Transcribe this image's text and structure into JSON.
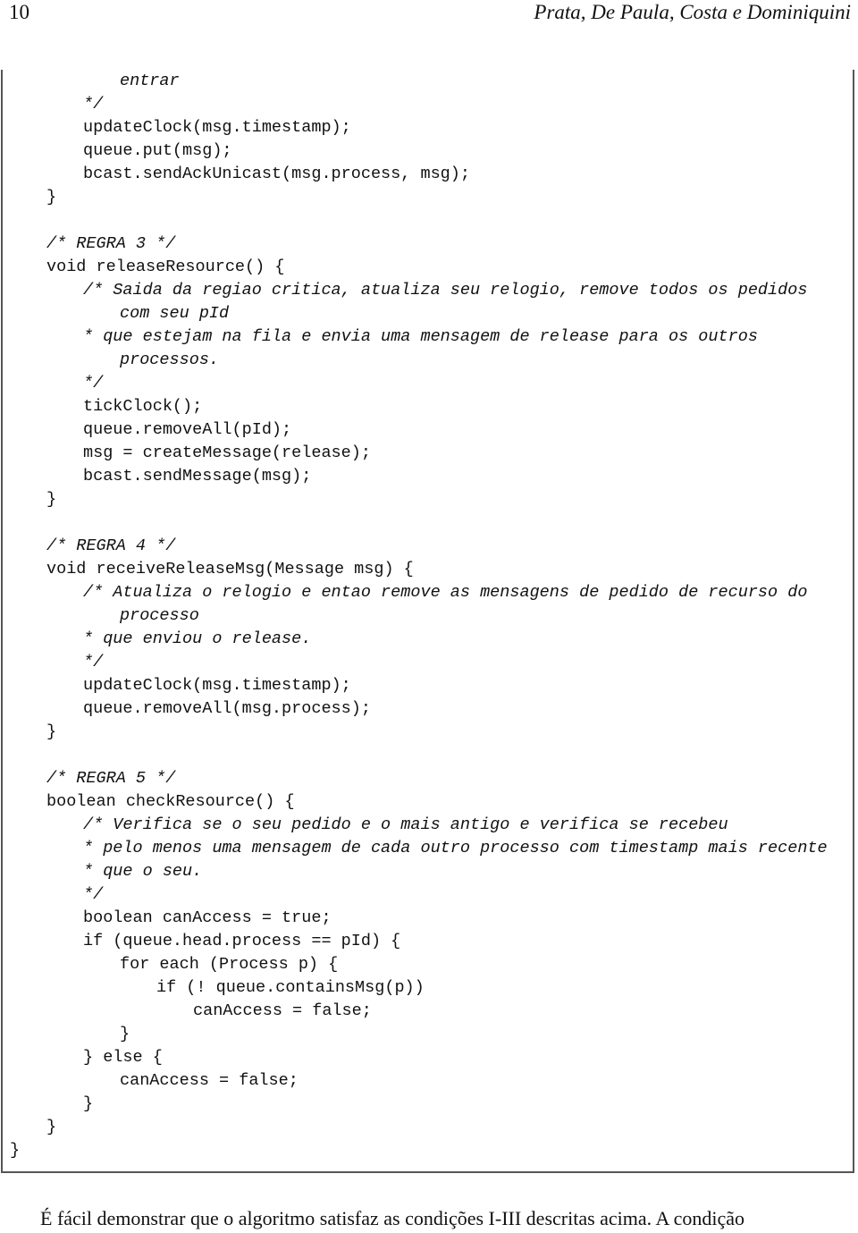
{
  "header": {
    "page_number": "10",
    "authors": "Prata, De Paula, Costa e Dominiquini"
  },
  "code": {
    "lines": [
      {
        "text": "entrar",
        "indent": 3,
        "comment": true
      },
      {
        "text": "*/",
        "indent": 2,
        "comment": true
      },
      {
        "text": "updateClock(msg.timestamp);",
        "indent": 2,
        "comment": false
      },
      {
        "text": "queue.put(msg);",
        "indent": 2,
        "comment": false
      },
      {
        "text": "bcast.sendAckUnicast(msg.process, msg);",
        "indent": 2,
        "comment": false
      },
      {
        "text": "}",
        "indent": 1,
        "comment": false
      },
      {
        "text": "",
        "indent": 1,
        "comment": false
      },
      {
        "text": "/* REGRA 3 */",
        "indent": 1,
        "comment": true
      },
      {
        "text": "void releaseResource() {",
        "indent": 1,
        "comment": false
      },
      {
        "text": "/* Saida da regiao critica, atualiza seu relogio, remove todos os pedidos",
        "indent": 2,
        "comment": true
      },
      {
        "text": "com seu pId",
        "indent": 3,
        "comment": true
      },
      {
        "text": "* que estejam na fila e envia uma mensagem de release para os outros",
        "indent": 2,
        "comment": true
      },
      {
        "text": "processos.",
        "indent": 3,
        "comment": true
      },
      {
        "text": "*/",
        "indent": 2,
        "comment": true
      },
      {
        "text": "tickClock();",
        "indent": 2,
        "comment": false
      },
      {
        "text": "queue.removeAll(pId);",
        "indent": 2,
        "comment": false
      },
      {
        "text": "msg = createMessage(release);",
        "indent": 2,
        "comment": false
      },
      {
        "text": "bcast.sendMessage(msg);",
        "indent": 2,
        "comment": false
      },
      {
        "text": "}",
        "indent": 1,
        "comment": false
      },
      {
        "text": "",
        "indent": 1,
        "comment": false
      },
      {
        "text": "/* REGRA 4 */",
        "indent": 1,
        "comment": true
      },
      {
        "text": "void receiveReleaseMsg(Message msg) {",
        "indent": 1,
        "comment": false
      },
      {
        "text": "/* Atualiza o relogio e entao remove as mensagens de pedido de recurso do",
        "indent": 2,
        "comment": true
      },
      {
        "text": "processo",
        "indent": 3,
        "comment": true
      },
      {
        "text": "* que enviou o release.",
        "indent": 2,
        "comment": true
      },
      {
        "text": "*/",
        "indent": 2,
        "comment": true
      },
      {
        "text": "updateClock(msg.timestamp);",
        "indent": 2,
        "comment": false
      },
      {
        "text": "queue.removeAll(msg.process);",
        "indent": 2,
        "comment": false
      },
      {
        "text": "}",
        "indent": 1,
        "comment": false
      },
      {
        "text": "",
        "indent": 1,
        "comment": false
      },
      {
        "text": "/* REGRA 5 */",
        "indent": 1,
        "comment": true
      },
      {
        "text": "boolean checkResource() {",
        "indent": 1,
        "comment": false
      },
      {
        "text": "/* Verifica se o seu pedido e o mais antigo e verifica se recebeu",
        "indent": 2,
        "comment": true
      },
      {
        "text": "* pelo menos uma mensagem de cada outro processo com timestamp mais recente",
        "indent": 2,
        "comment": true
      },
      {
        "text": "* que o seu.",
        "indent": 2,
        "comment": true
      },
      {
        "text": "*/",
        "indent": 2,
        "comment": true
      },
      {
        "text": "boolean canAccess = true;",
        "indent": 2,
        "comment": false
      },
      {
        "text": "if (queue.head.process == pId) {",
        "indent": 2,
        "comment": false
      },
      {
        "text": "for each (Process p) {",
        "indent": 3,
        "comment": false
      },
      {
        "text": "if (! queue.containsMsg(p))",
        "indent": 4,
        "comment": false
      },
      {
        "text": "canAccess = false;",
        "indent": 5,
        "comment": false
      },
      {
        "text": "}",
        "indent": 3,
        "comment": false
      },
      {
        "text": "} else {",
        "indent": 2,
        "comment": false
      },
      {
        "text": "canAccess = false;",
        "indent": 3,
        "comment": false
      },
      {
        "text": "}",
        "indent": 2,
        "comment": false
      },
      {
        "text": "}",
        "indent": 1,
        "comment": false
      },
      {
        "text": "}",
        "indent": 0,
        "comment": false
      }
    ]
  },
  "body_text": {
    "paragraph": "É fácil demonstrar que o algoritmo satisfaz as condições I-III descritas acima.  A condição"
  }
}
